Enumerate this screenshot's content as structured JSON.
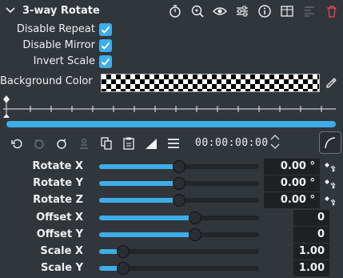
{
  "header": {
    "title": "3-way Rotate",
    "icons": [
      "timer-icon",
      "zoom-reset-icon",
      "eye-icon",
      "adjust-icon",
      "info-icon",
      "columns-icon",
      "align-icon",
      "delete-icon"
    ]
  },
  "checkboxes": [
    {
      "label": "Disable Repeat",
      "checked": true
    },
    {
      "label": "Disable Mirror",
      "checked": true
    },
    {
      "label": "Invert Scale",
      "checked": true
    }
  ],
  "background": {
    "label": "Background Color",
    "swatch": "checkered"
  },
  "timeline": {
    "progress_fraction": 1.0
  },
  "toolbar": {
    "timecode": "00:00:00:00"
  },
  "params": [
    {
      "label": "Rotate X",
      "value": "0.00 °",
      "level": 0.5,
      "keyframe": true
    },
    {
      "label": "Rotate Y",
      "value": "0.00 °",
      "level": 0.5,
      "keyframe": true
    },
    {
      "label": "Rotate Z",
      "value": "0.00 °",
      "level": 0.5,
      "keyframe": true
    },
    {
      "label": "Offset X",
      "value": "0",
      "level": 0.6,
      "keyframe": false
    },
    {
      "label": "Offset Y",
      "value": "0",
      "level": 0.6,
      "keyframe": false
    },
    {
      "label": "Scale X",
      "value": "1.00",
      "level": 0.15,
      "keyframe": false
    },
    {
      "label": "Scale Y",
      "value": "1.00",
      "level": 0.15,
      "keyframe": false
    }
  ],
  "colors": {
    "accent": "#3daee9",
    "background": "#31363b",
    "delete": "#da4453"
  }
}
